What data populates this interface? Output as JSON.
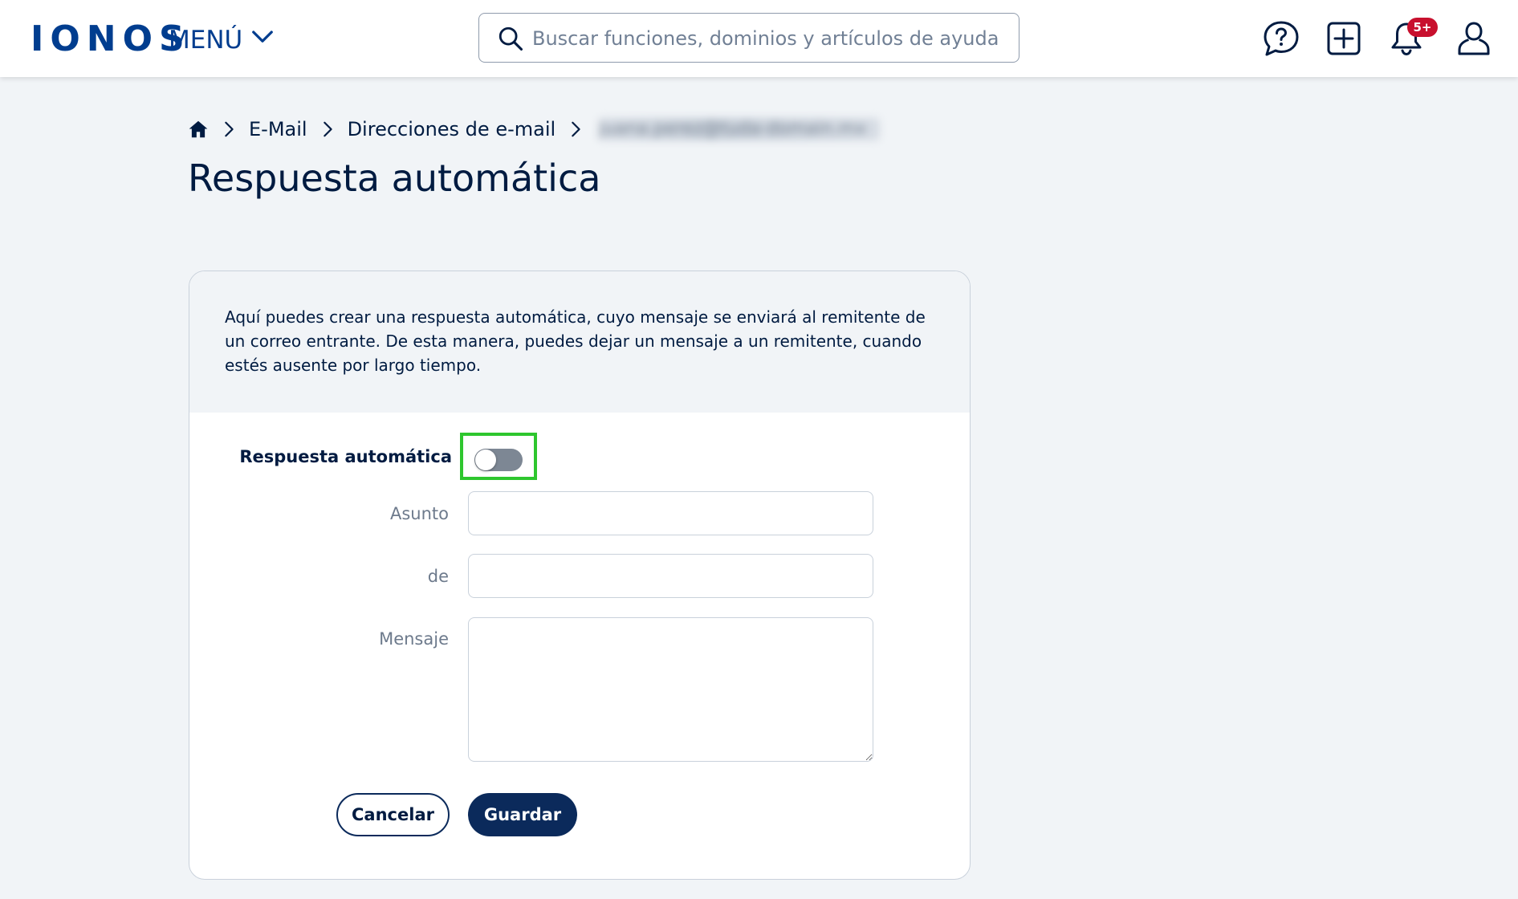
{
  "header": {
    "logo": "IONOS",
    "menu_label": "MENÚ",
    "search_placeholder": "Buscar funciones, dominios y artículos de ayuda",
    "notifications_badge": "5+"
  },
  "breadcrumb": {
    "items": [
      "E-Mail",
      "Direcciones de e-mail"
    ],
    "current_blurred": "juana.perez@tuda-domain.mx"
  },
  "page": {
    "title": "Respuesta automática"
  },
  "card": {
    "intro": "Aquí puedes crear una respuesta automática, cuyo mensaje se enviará al remitente de un correo entrante. De esta manera, puedes dejar un mensaje a un remitente, cuando estés ausente por largo tiempo.",
    "toggle_label": "Respuesta automática",
    "toggle_on": false,
    "fields": {
      "subject_label": "Asunto",
      "subject_value": "",
      "from_label": "de",
      "from_value": "",
      "message_label": "Mensaje",
      "message_value": ""
    },
    "buttons": {
      "cancel": "Cancelar",
      "save": "Guardar"
    }
  },
  "colors": {
    "brand": "#003d8f",
    "navy": "#0b2a5b",
    "highlight": "#2ec62e",
    "badge": "#c8102e"
  }
}
